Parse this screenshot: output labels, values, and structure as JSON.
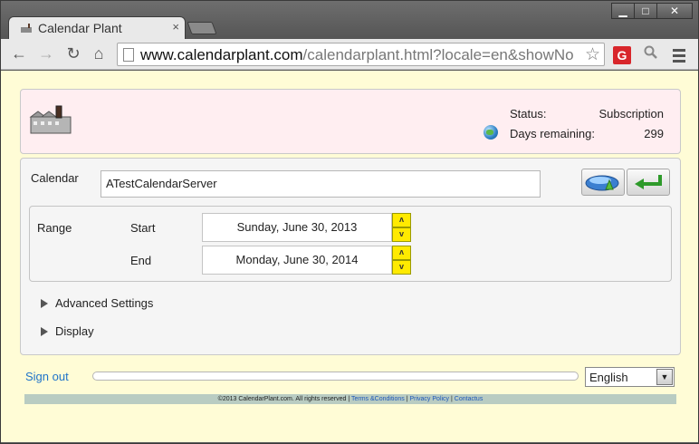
{
  "browser": {
    "tab_title": "Calendar Plant",
    "tab_close": "×",
    "url_host": "www.calendarplant.com",
    "url_path": "/calendarplant.html?locale=en&showNo",
    "window_buttons": {
      "minimize": "▁",
      "maximize": "□",
      "close": "✕"
    },
    "nav": {
      "back": "←",
      "forward": "→",
      "reload": "↻",
      "home": "⌂"
    },
    "star": "☆",
    "extension_g": "G"
  },
  "header": {
    "status_label": "Status:",
    "status_value": "Subscription",
    "days_label": "Days remaining:",
    "days_value": "299"
  },
  "form": {
    "calendar_label": "Calendar",
    "calendar_value": "ATestCalendarServer",
    "range_label": "Range",
    "start_label": "Start",
    "start_value": "Sunday, June 30, 2013",
    "end_label": "End",
    "end_value": "Monday, June 30, 2014",
    "spin_up": "ʌ",
    "spin_down": "v",
    "advanced_settings": "Advanced Settings",
    "display": "Display"
  },
  "bottom": {
    "sign_out": "Sign out",
    "progress_fraction": 0,
    "language": "English",
    "dropdown_arrow": "▼"
  },
  "footer": {
    "copyright": "©2013 CalendarPlant.com. All rights reserved",
    "sep": "|",
    "terms": "Terms &Conditions",
    "privacy": "Privacy Policy",
    "contact": "Contactus"
  }
}
